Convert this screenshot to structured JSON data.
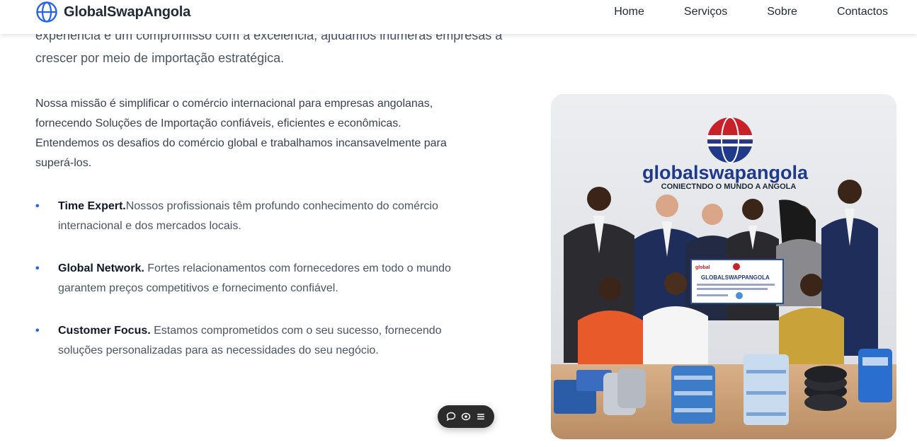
{
  "brand": {
    "name": "GlobalSwapAngola",
    "icon": "globe-icon",
    "accent": "#2563eb"
  },
  "nav": {
    "items": [
      "Home",
      "Serviços",
      "Sobre",
      "Contactos"
    ]
  },
  "content": {
    "intro": "experiência e um compromisso com a excelência, ajudamos inúmeras empresas a crescer por meio de importação estratégica.",
    "mission": "Nossa missão é simplificar o comércio internacional para empresas angolanas, fornecendo Soluções de Importação confiáveis, eficientes e econômicas. Entendemos os desafios do comércio global e trabalhamos incansavelmente para superá-los.",
    "features": [
      {
        "title": "Time Expert.",
        "text": "Nossos profissionais têm profundo conhecimento do comércio internacional e dos mercados locais."
      },
      {
        "title": "Global Network.",
        "text": " Fortes relacionamentos com fornecedores em todo o mundo garantem preços competitivos e fornecimento confiável."
      },
      {
        "title": "Customer Focus.",
        "text": " Estamos comprometidos com o seu sucesso, fornecendo soluções personalizadas para as necessidades do seu negócio."
      }
    ]
  },
  "image": {
    "wall_logo": "globalswapangola",
    "wall_tagline": "CONIECTNDO O MUNDO A ANGOLA",
    "check_title": "GLOBALSWAPPANGOLA",
    "check_logo": "global"
  },
  "floating_toolbar": {
    "icons": [
      "comment-icon",
      "eye-icon",
      "menu-icon"
    ]
  }
}
